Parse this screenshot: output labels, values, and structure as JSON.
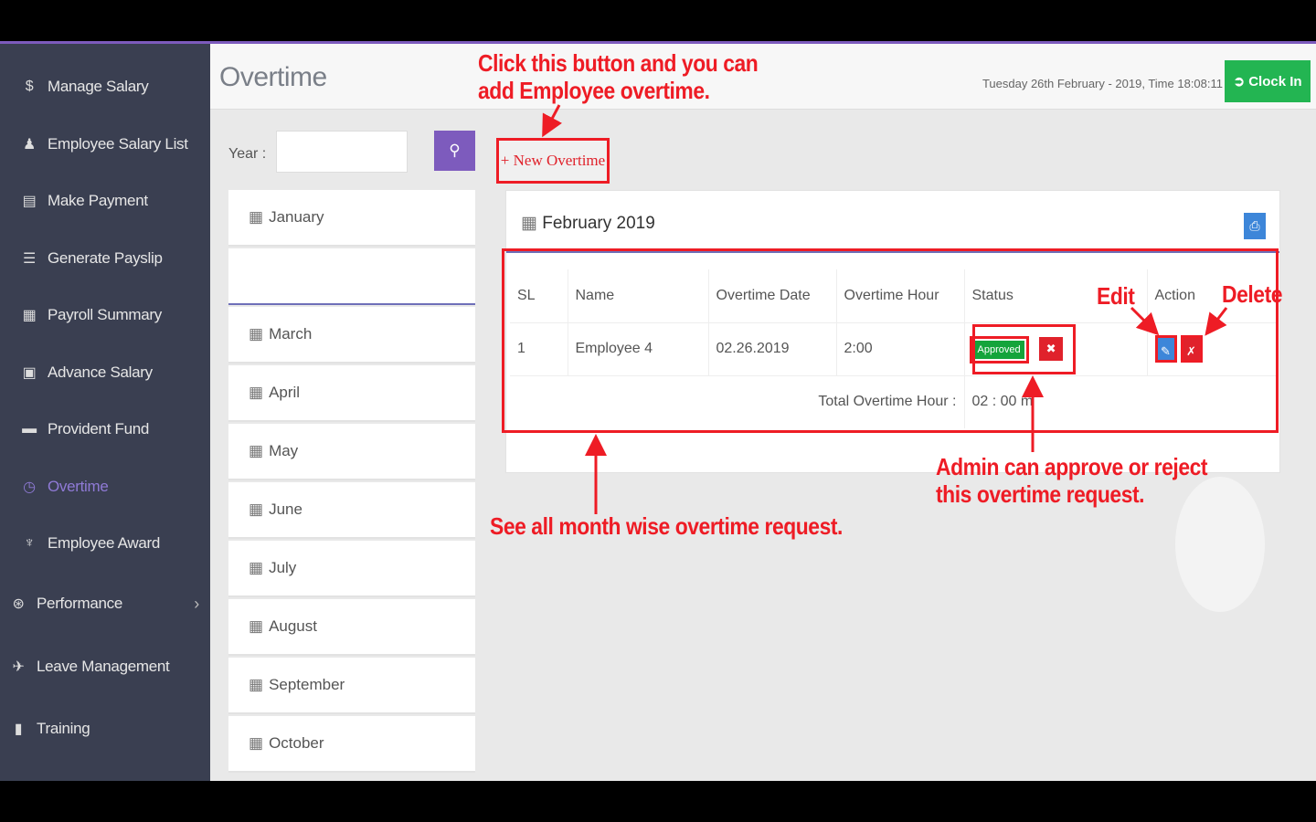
{
  "sidebar": {
    "items": [
      {
        "label": "Manage Salary",
        "icon": "dollar-icon",
        "glyph": "$"
      },
      {
        "label": "Employee Salary List",
        "icon": "user-icon",
        "glyph": "👤"
      },
      {
        "label": "Make Payment",
        "icon": "list-icon",
        "glyph": "▤"
      },
      {
        "label": "Generate Payslip",
        "icon": "list-lines-icon",
        "glyph": "☰"
      },
      {
        "label": "Payroll Summary",
        "icon": "calculator-icon",
        "glyph": "▦"
      },
      {
        "label": "Advance Salary",
        "icon": "money-icon",
        "glyph": "▣"
      },
      {
        "label": "Provident Fund",
        "icon": "briefcase-icon",
        "glyph": "▬"
      },
      {
        "label": "Overtime",
        "icon": "clock-icon",
        "glyph": "◷"
      },
      {
        "label": "Employee Award",
        "icon": "trophy-icon",
        "glyph": "♆"
      },
      {
        "label": "Performance",
        "icon": "dribbble-icon",
        "glyph": "⊛"
      },
      {
        "label": "Leave Management",
        "icon": "plane-icon",
        "glyph": "✈"
      },
      {
        "label": "Training",
        "icon": "suitcase-icon",
        "glyph": "▮"
      }
    ],
    "chevron": "›"
  },
  "header": {
    "title": "Overtime",
    "datetime": "Tuesday 26th February - 2019,  Time  18:08:11",
    "clock_in": "Clock In"
  },
  "search": {
    "year_label": "Year :",
    "year_value": "",
    "search_glyph": "🔍"
  },
  "months": [
    "January",
    "",
    "March",
    "April",
    "May",
    "June",
    "July",
    "August",
    "September",
    "October"
  ],
  "new_overtime": "+ New Overtime",
  "panel": {
    "title": "February 2019",
    "pdf_glyph": "⎙",
    "columns": [
      "SL",
      "Name",
      "Overtime Date",
      "Overtime Hour",
      "Status",
      "Action"
    ],
    "rows": [
      {
        "sl": "1",
        "name": "Employee 4",
        "date": "02.26.2019",
        "hour": "2:00",
        "status": "Approved"
      }
    ],
    "total_label": "Total Overtime Hour :",
    "total_value": "02 : 00 m",
    "reject_glyph": "✖",
    "edit_glyph": "✎",
    "delete_glyph": "🗑"
  },
  "annotations": {
    "new_button": "Click this button and you can\nadd Employee overtime.",
    "edit": "Edit",
    "delete": "Delete",
    "approve": "Admin can approve or reject\nthis overtime request.",
    "month_wise": "See all month wise overtime request."
  },
  "colors": {
    "sidebar_bg": "#3a3f51",
    "accent": "#7d5bbd",
    "annotation_red": "#ee1c25",
    "clock_in_green": "#23b552",
    "approved_green": "#14a43b",
    "edit_blue": "#3d86d9"
  }
}
